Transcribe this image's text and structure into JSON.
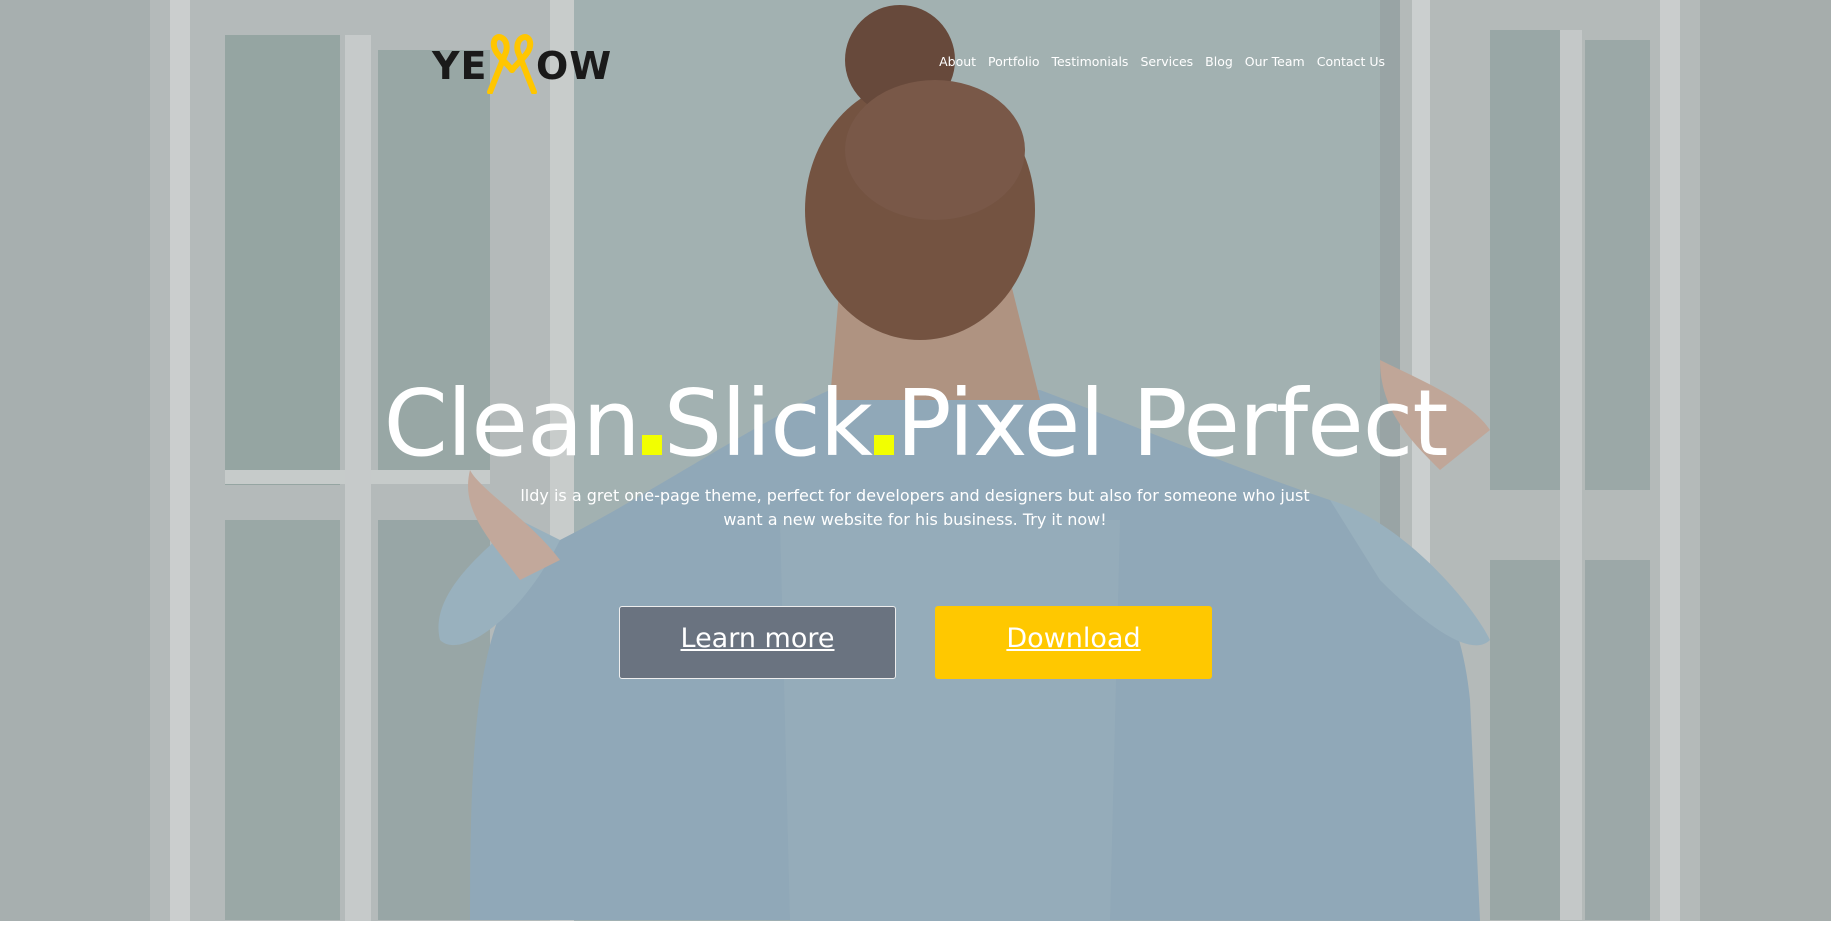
{
  "brand": {
    "logo_text_left": "YE",
    "logo_text_right": "OW",
    "logo_full": "YELLOW",
    "accent_color": "#ffc600",
    "dot_color": "#f2ff00"
  },
  "nav": {
    "items": [
      {
        "label": "About"
      },
      {
        "label": "Portfolio"
      },
      {
        "label": "Testimonials"
      },
      {
        "label": "Services"
      },
      {
        "label": "Blog"
      },
      {
        "label": "Our Team"
      },
      {
        "label": "Contact Us"
      }
    ]
  },
  "hero": {
    "headline": {
      "part1": "Clean",
      "part2": "Slick",
      "part3": "Pixel Perfect"
    },
    "subtitle": "lldy is a gret one-page theme, perfect for developers and designers but also for someone who just want a new website for his business. Try it now!",
    "buttons": {
      "learn_more": "Learn more",
      "download": "Download"
    },
    "background": "woman-opening-window-photo"
  }
}
